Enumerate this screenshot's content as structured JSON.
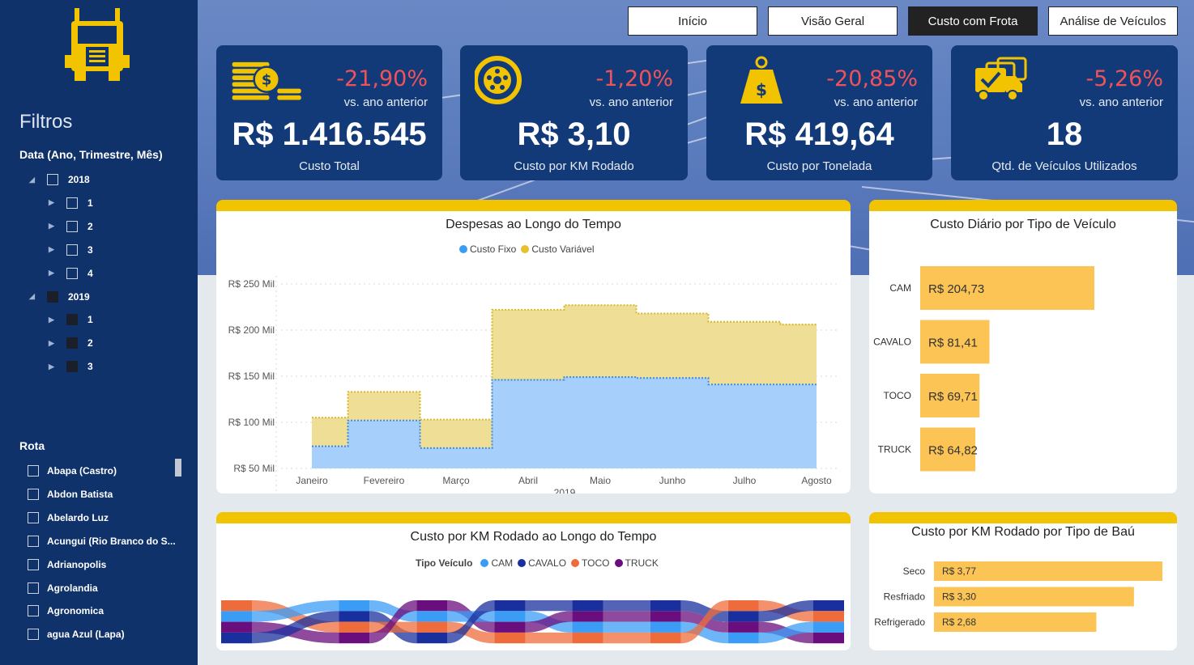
{
  "sidebar": {
    "filters_title": "Filtros",
    "date_label": "Data (Ano, Trimestre, Mês)",
    "tree": [
      {
        "label": "2018",
        "level": 0,
        "checked": false
      },
      {
        "label": "1",
        "level": 1,
        "checked": false
      },
      {
        "label": "2",
        "level": 1,
        "checked": false
      },
      {
        "label": "3",
        "level": 1,
        "checked": false
      },
      {
        "label": "4",
        "level": 1,
        "checked": false
      },
      {
        "label": "2019",
        "level": 0,
        "checked": true
      },
      {
        "label": "1",
        "level": 1,
        "checked": true
      },
      {
        "label": "2",
        "level": 1,
        "checked": true
      },
      {
        "label": "3",
        "level": 1,
        "checked": true
      }
    ],
    "rota_label": "Rota",
    "rotas": [
      "Abapa (Castro)",
      "Abdon Batista",
      "Abelardo Luz",
      "Acungui (Rio Branco do S...",
      "Adrianopolis",
      "Agrolandia",
      "Agronomica",
      "agua Azul (Lapa)"
    ]
  },
  "nav": {
    "tabs": [
      "Início",
      "Visão Geral",
      "Custo com Frota",
      "Análise de Veículos"
    ],
    "active": "Custo com Frota"
  },
  "kpis": [
    {
      "icon": "coins-dollar-icon",
      "change": "-21,90%",
      "vs": "vs. ano anterior",
      "value": "R$ 1.416.545",
      "caption": "Custo Total"
    },
    {
      "icon": "wheel-icon",
      "change": "-1,20%",
      "vs": "vs. ano anterior",
      "value": "R$ 3,10",
      "caption": "Custo por KM Rodado"
    },
    {
      "icon": "weight-dollar-icon",
      "change": "-20,85%",
      "vs": "vs. ano anterior",
      "value": "R$ 419,64",
      "caption": "Custo por Tonelada"
    },
    {
      "icon": "fleet-trucks-icon",
      "change": "-5,26%",
      "vs": "vs. ano anterior",
      "value": "18",
      "caption": "Qtd. de Veículos Utilizados"
    }
  ],
  "colors": {
    "accent_yellow": "#f2c300",
    "kpi_bg": "#133a78",
    "negative": "#f0525a",
    "custo_fixo": "#a6d0fb",
    "custo_variavel": "#efdf96",
    "bar": "#fbc454",
    "cam": "#3b9cf5",
    "cavalo": "#1a2f9e",
    "toco": "#ee6c3b",
    "truck": "#6a0e7e"
  },
  "chart_data": [
    {
      "type": "area",
      "title": "Despesas ao Longo do Tempo",
      "xlabel": "2019",
      "categories": [
        "Janeiro",
        "Fevereiro",
        "Março",
        "Abril",
        "Maio",
        "Junho",
        "Julho",
        "Agosto"
      ],
      "y_ticks": [
        "R$ 50 Mil",
        "R$ 100 Mil",
        "R$ 150 Mil",
        "R$ 200 Mil",
        "R$ 250 Mil"
      ],
      "ylim": [
        50,
        250
      ],
      "series": [
        {
          "name": "Custo Fixo",
          "values": [
            74,
            102,
            72,
            146,
            149,
            148,
            141,
            141
          ]
        },
        {
          "name": "Custo Variável",
          "values": [
            31,
            31,
            31,
            76,
            78,
            70,
            68,
            65
          ]
        }
      ],
      "stacked": true
    },
    {
      "type": "bar",
      "orientation": "horizontal",
      "title": "Custo Diário por Tipo de Veículo",
      "categories": [
        "CAM",
        "CAVALO",
        "TOCO",
        "TRUCK"
      ],
      "values": [
        204.73,
        81.41,
        69.71,
        64.82
      ],
      "labels": [
        "R$ 204,73",
        "R$ 81,41",
        "R$ 69,71",
        "R$ 64,82"
      ]
    },
    {
      "type": "ribbon",
      "title": "Custo por KM Rodado ao Longo do Tempo",
      "legend_title": "Tipo Veículo",
      "series": [
        {
          "name": "CAM"
        },
        {
          "name": "CAVALO"
        },
        {
          "name": "TOCO"
        },
        {
          "name": "TRUCK"
        }
      ],
      "rank_order": [
        [
          "TOCO",
          "CAM",
          "TRUCK",
          "CAVALO"
        ],
        [
          "CAM",
          "CAVALO",
          "TOCO",
          "TRUCK"
        ],
        [
          "TRUCK",
          "CAM",
          "TOCO",
          "CAVALO"
        ],
        [
          "CAVALO",
          "CAM",
          "TRUCK",
          "TOCO"
        ],
        [
          "CAVALO",
          "TRUCK",
          "CAM",
          "TOCO"
        ],
        [
          "CAVALO",
          "TRUCK",
          "CAM",
          "TOCO"
        ],
        [
          "TOCO",
          "CAVALO",
          "TRUCK",
          "CAM"
        ],
        [
          "CAVALO",
          "TOCO",
          "CAM",
          "TRUCK"
        ]
      ]
    },
    {
      "type": "bar",
      "orientation": "horizontal",
      "title": "Custo por KM Rodado por Tipo de Baú",
      "categories": [
        "Seco",
        "Resfriado",
        "Refrigerado"
      ],
      "values": [
        3.77,
        3.3,
        2.68
      ],
      "labels": [
        "R$ 3,77",
        "R$ 3,30",
        "R$ 2,68"
      ]
    }
  ]
}
